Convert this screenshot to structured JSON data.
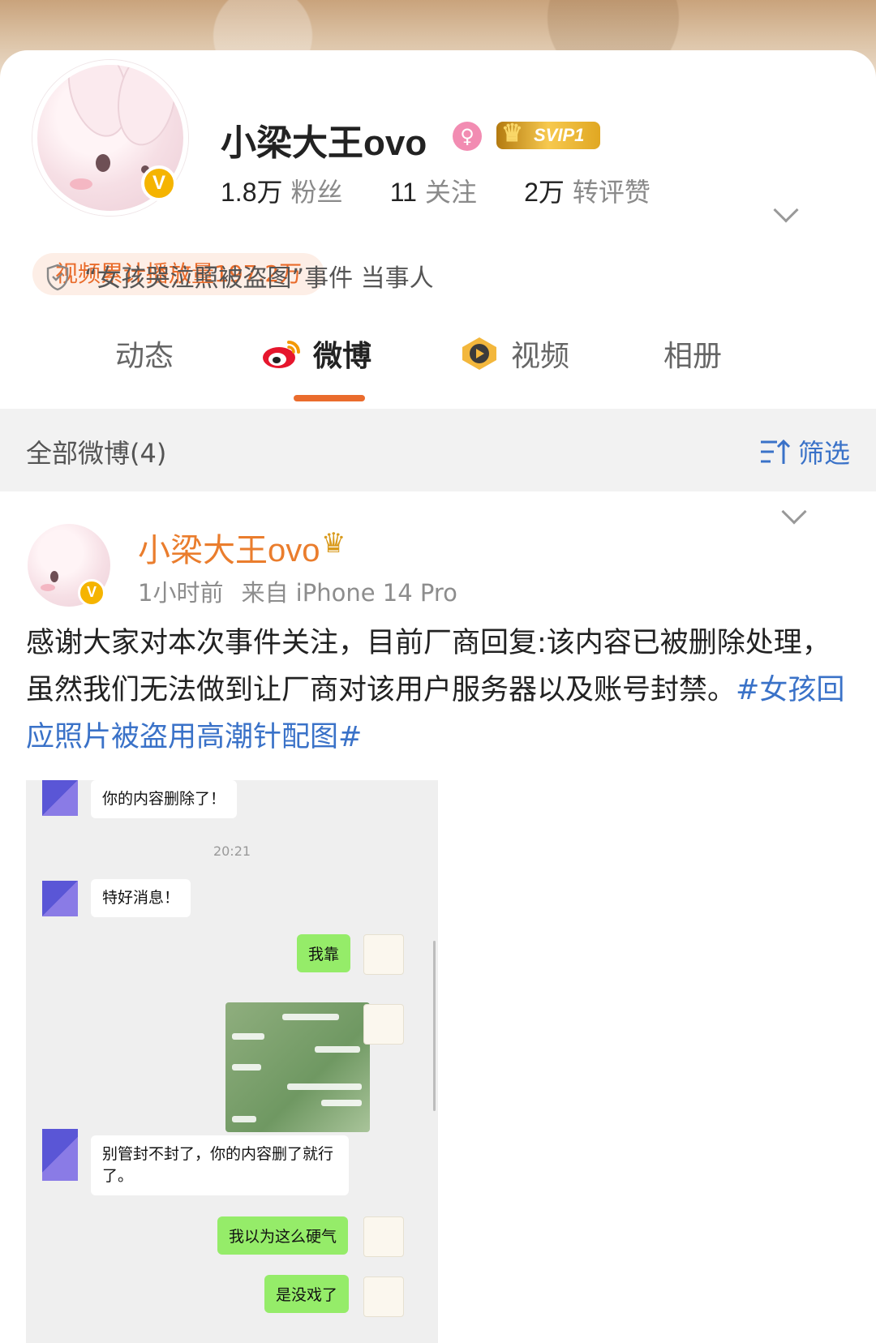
{
  "profile": {
    "username": "小梁大王ovo",
    "svip": "SVIP1",
    "stats": [
      {
        "num": "1.8万",
        "label": "粉丝"
      },
      {
        "num": "11",
        "label": "关注"
      },
      {
        "num": "2万",
        "label": "转评赞"
      }
    ],
    "video_plays": "视频累计播放量197.2万",
    "event_tag": "“女孩哭泣照被盗图”事件 当事人",
    "gender": "female"
  },
  "tabs": [
    {
      "label": "动态",
      "active": false
    },
    {
      "label": "微博",
      "active": true
    },
    {
      "label": "视频",
      "active": false
    },
    {
      "label": "相册",
      "active": false
    }
  ],
  "filter_bar": {
    "all_label": "全部微博(4)",
    "filter_label": "筛选"
  },
  "post": {
    "author": "小梁大王ovo",
    "time": "1小时前",
    "source": "来自 iPhone 14 Pro",
    "text": "感谢大家对本次事件关注，目前厂商回复:该内容已被删除处理，虽然我们无法做到让厂商对该用户服务器以及账号封禁。",
    "hashtag": "#女孩回应照片被盗用高潮针配图#",
    "chat": {
      "msg1": "你的内容删除了！",
      "time": "20:21",
      "msg2": "特好消息！",
      "reply1": "我靠",
      "msg3": "别管封不封了，你的内容删了就行了。",
      "reply2": "我以为这么硬气",
      "reply3": "是没戏了"
    }
  },
  "colors": {
    "accent": "#ea6c2d",
    "link": "#3a72c8",
    "vip_gold": "#f5b400"
  }
}
